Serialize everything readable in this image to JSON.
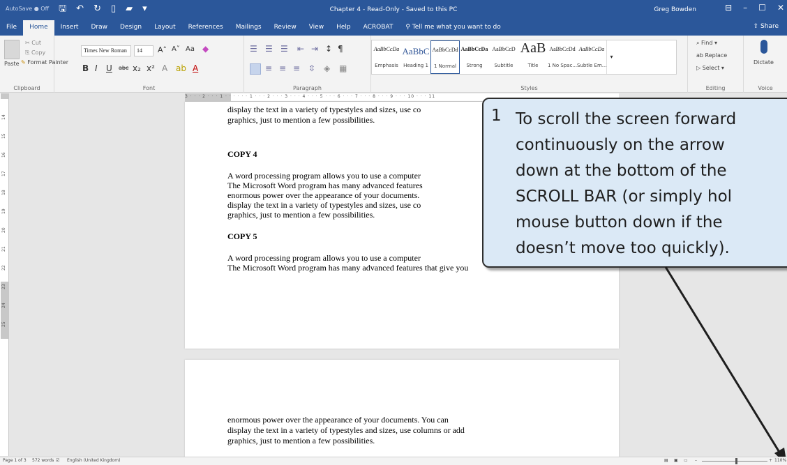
{
  "title_bar": {
    "autosave_label": "AutoSave ● Off",
    "window_title": "Chapter 4 - Read-Only - Saved to this PC",
    "user_name": "Greg Bowden"
  },
  "tabs": [
    "File",
    "Home",
    "Insert",
    "Draw",
    "Design",
    "Layout",
    "References",
    "Mailings",
    "Review",
    "View",
    "Help",
    "ACROBAT"
  ],
  "active_tab": "Home",
  "tell_me": "Tell me what you want to do",
  "share_label": "Share",
  "ribbon": {
    "clipboard": {
      "paste": "Paste",
      "cut": "Cut",
      "copy": "Copy",
      "format_painter": "Format Painter",
      "label": "Clipboard"
    },
    "font": {
      "name": "Times New Roman",
      "size": "14",
      "label": "Font"
    },
    "paragraph": {
      "label": "Paragraph"
    },
    "styles": {
      "label": "Styles",
      "items": [
        {
          "sample": "AaBbCcDa",
          "name": "Emphasis"
        },
        {
          "sample": "AaBbC",
          "name": "Heading 1"
        },
        {
          "sample": "AaBbCcDd",
          "name": "1 Normal"
        },
        {
          "sample": "AaBbCcDa",
          "name": "Strong"
        },
        {
          "sample": "AaBbCcD",
          "name": "Subtitle"
        },
        {
          "sample": "AaB",
          "name": "Title"
        },
        {
          "sample": "AaBbCcDd",
          "name": "1 No Spac..."
        },
        {
          "sample": "AaBbCcDa",
          "name": "Subtle Em..."
        }
      ]
    },
    "editing": {
      "find": "Find",
      "replace": "Replace",
      "select": "Select",
      "label": "Editing"
    },
    "voice": {
      "dictate": "Dictate",
      "label": "Voice"
    }
  },
  "ruler": {
    "ticks": "3 · · · 2 · · · 1 · · · · · · 1 · · · 2 · · · 3 · · · 4 · · · 5 · · · 6 · · · 7 · · · 8 · · · 9 · · · 10 · · · 11",
    "vertical_numbers": [
      "14",
      "15",
      "16",
      "17",
      "18",
      "19",
      "20",
      "21",
      "22",
      "23",
      "24",
      "25"
    ]
  },
  "document": {
    "page1": {
      "lines_top": [
        "display the text in a variety of typestyles and sizes, use co",
        "graphics, just to mention a few possibilities."
      ],
      "heading4": "COPY 4",
      "lines_copy4": [
        "A word processing program allows you to use a computer",
        "The Microsoft Word program has many advanced features",
        "enormous power over the appearance of your documents.",
        "display the text in a variety of typestyles and sizes, use co",
        "graphics, just to mention a few possibilities."
      ],
      "heading5": "COPY 5",
      "lines_copy5": [
        "A word processing program allows you to use a computer",
        "The Microsoft Word program has many advanced features that give you"
      ]
    },
    "page2": {
      "lines": [
        "enormous power over the appearance of your documents.  You can",
        "display the text in a variety of typestyles and sizes, use columns or add",
        "graphics, just to mention a few possibilities."
      ]
    }
  },
  "callout": {
    "number": "1",
    "text": "To scroll the screen forward\ncontinuously on the arrow\ndown at the bottom of the\nSCROLL BAR (or simply hol\nmouse button down if the\ndoesn’t move too quickly)."
  },
  "status_bar": {
    "page": "Page 1 of 3",
    "words": "572 words",
    "language": "English (United Kingdom)",
    "zoom": "110%"
  },
  "colors": {
    "word_blue": "#2b579a",
    "callout_fill": "#dbe9f6"
  }
}
